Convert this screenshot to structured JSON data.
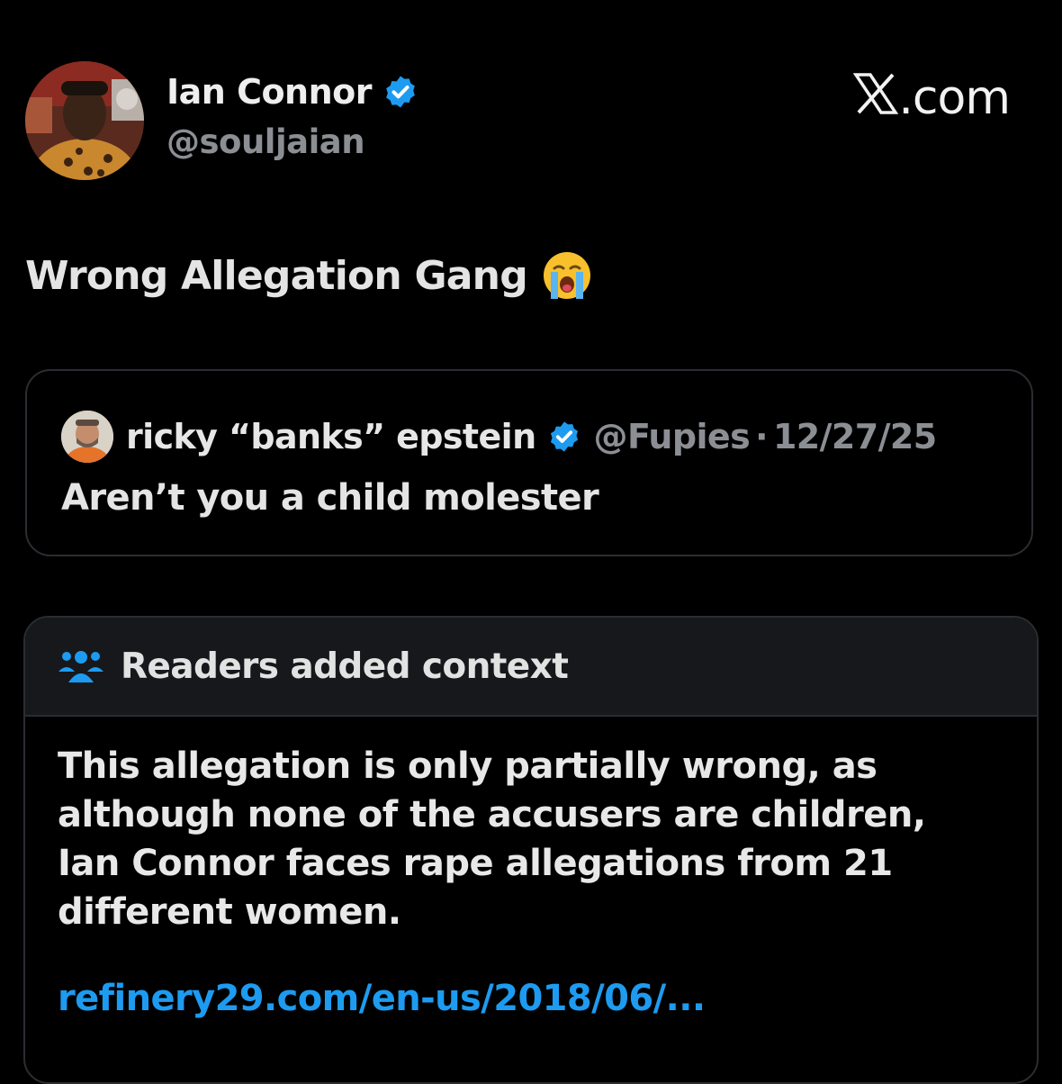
{
  "post": {
    "author_name": "Ian Connor",
    "author_handle": "@souljaian",
    "brand": ".com",
    "text": "Wrong Allegation Gang",
    "emoji_icon": "loudly-crying-face-icon"
  },
  "quoted": {
    "author_name": "ricky “banks” epstein",
    "author_handle": "@Fupies",
    "separator": "·",
    "date": "12/27/25",
    "text": "Aren’t you a child molester"
  },
  "context": {
    "title": "Readers added context",
    "body": "This allegation is only partially wrong, as although none of the accusers are children, Ian Connor faces rape allegations from 21 different women.",
    "link": "refinery29.com/en-us/2018/06/..."
  },
  "colors": {
    "background": "#000000",
    "verified": "#1d9bf0",
    "link": "#1d9bf0",
    "muted": "#8b8f94"
  }
}
